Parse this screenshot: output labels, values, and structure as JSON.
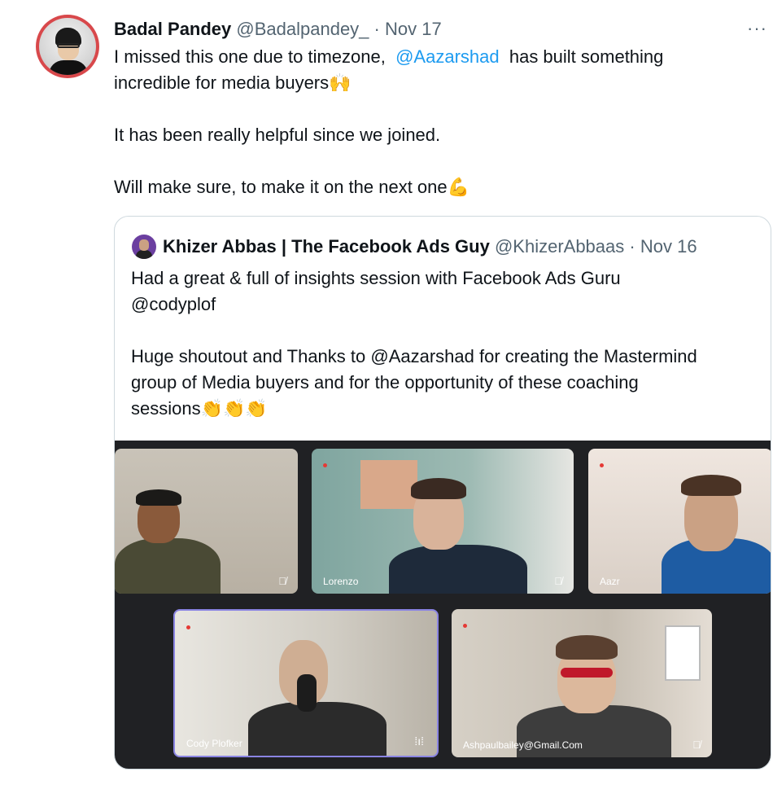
{
  "tweet": {
    "author_name": "Badal Pandey",
    "author_handle": "@Badalpandey_",
    "separator": "·",
    "date": "Nov 17",
    "more_label": "···",
    "line1_pre": "I missed this one due to timezone,",
    "line1_mention": "@Aazarshad",
    "line1_post": "has built something",
    "line2": "incredible for media buyers",
    "line2_emoji": "🙌",
    "line3": "It has been really helpful since we joined.",
    "line4": "Will make sure, to make it on the next one",
    "line4_emoji": "💪"
  },
  "quote": {
    "author_name": "Khizer Abbas | The Facebook Ads Guy",
    "author_handle": "@KhizerAbbaas",
    "separator": "·",
    "date": "Nov 16",
    "line1": "Had a great & full of insights session with Facebook Ads Guru",
    "line2": "@codyplof",
    "line3": "Huge shoutout and Thanks to @Aazarshad for creating the Mastermind",
    "line4": "group of Media buyers and for the opportunity of these coaching",
    "line5": "sessions",
    "line5_emoji": "👏👏👏",
    "participants": [
      {
        "label": "",
        "muted": true
      },
      {
        "label": "Lorenzo",
        "muted": true
      },
      {
        "label": "Aazr",
        "muted": false
      },
      {
        "label": "Cody Plofker",
        "muted": false,
        "speaking": true
      },
      {
        "label": "Ashpaulbailey@Gmail.Com",
        "muted": true
      }
    ]
  },
  "colors": {
    "mention": "#1d9bf0",
    "secondary": "#536471",
    "avatar_ring": "#d8484b",
    "active_tile": "#8a84e2"
  },
  "icons": {
    "muted": "mic-off-icon",
    "speaking": "audio-wave-icon",
    "more": "more-dots-icon"
  }
}
